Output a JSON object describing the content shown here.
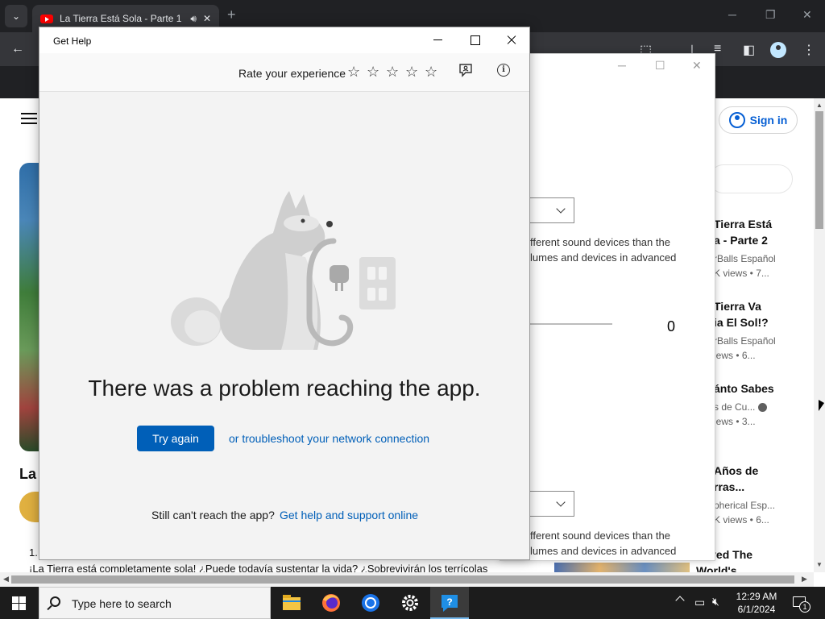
{
  "browser": {
    "tab_title": "La Tierra Está Sola - Parte 1",
    "page": {
      "title_partial": "La",
      "desc_number": "1.",
      "description": "¡La Tierra está completamente sola! ¿Puede todavía sustentar la vida? ¿Sobrevivirán los terrícolas",
      "sign_in_label": "Sign in"
    },
    "recommendations": [
      {
        "title1": "Tierra Está",
        "title2": "a - Parte 2",
        "channel": "rBalls Español",
        "meta": "K views  • 7..."
      },
      {
        "title1": "Tierra Va",
        "title2": "ia El Sol!?",
        "channel": "rBalls Español",
        "meta": "iews  • 6..."
      },
      {
        "title1": "ánto Sabes",
        "title2": "",
        "channel": "s de Cu...",
        "meta": "iews  • 3..."
      },
      {
        "title1": "Años de",
        "title2": "rras...",
        "channel": "pherical Esp...",
        "meta": "K views  • 6..."
      }
    ],
    "last_rec_title1": "rvived The",
    "last_rec_title2": "World's..."
  },
  "sound_settings": {
    "text1_line1": "fferent sound devices than the",
    "text1_line2": "lumes and devices in advanced",
    "volume_value": "0",
    "text2_line1": "fferent sound devices than the",
    "text2_line2": "lumes and devices in advanced"
  },
  "get_help": {
    "window_title": "Get Help",
    "rate_label": "Rate your experience",
    "stars": [
      "☆",
      "☆",
      "☆",
      "☆",
      "☆"
    ],
    "error_message": "There was a problem reaching the app.",
    "try_again_label": "Try again",
    "troubleshoot_link": "or troubleshoot your network connection",
    "still_cant_reach": "Still can't reach the app?",
    "support_link": "Get help and support online"
  },
  "taskbar": {
    "search_placeholder": "Type here to search",
    "time": "12:29 AM",
    "date": "6/1/2024",
    "notification_count": "1",
    "apps": [
      "file-explorer-icon",
      "firefox-icon",
      "chrome-icon",
      "settings-icon",
      "get-help-icon"
    ]
  },
  "colors": {
    "accent": "#005fb8",
    "youtube_link": "#065fd4",
    "taskbar": "#1c1c1c",
    "chrome_dark": "#202124"
  }
}
